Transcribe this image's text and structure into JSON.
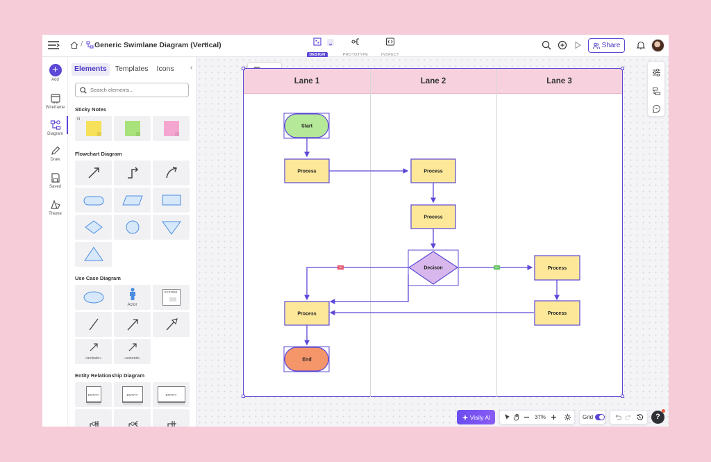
{
  "topbar": {
    "breadcrumb_sep": "/",
    "doc_title": "Generic Swimlane Diagram (Vertical)",
    "modes": [
      {
        "label": "DESIGN",
        "active": true
      },
      {
        "label": "PROTOTYPE",
        "active": false
      },
      {
        "label": "INSPECT",
        "active": false
      }
    ],
    "share_label": "Share"
  },
  "rail": {
    "items": [
      {
        "label": "Add",
        "icon": "plus-icon"
      },
      {
        "label": "Wireframe",
        "icon": "wireframe-icon"
      },
      {
        "label": "Diagram",
        "icon": "diagram-icon",
        "active": true
      },
      {
        "label": "Draw",
        "icon": "pen-icon"
      },
      {
        "label": "Saved",
        "icon": "saved-icon"
      },
      {
        "label": "Theme",
        "icon": "theme-icon"
      }
    ]
  },
  "panel": {
    "tabs": [
      "Elements",
      "Templates",
      "Icons"
    ],
    "active_tab": "Elements",
    "collapse_glyph": "‹",
    "search_placeholder": "Search elements...",
    "sections": {
      "sticky": "Sticky Notes",
      "flowchart": "Flowchart Diagram",
      "usecase": "Use Case Diagram",
      "er": "Entity Relationship Diagram"
    },
    "sticky_mark": "N",
    "sticky_colors": [
      "#f7e05a",
      "#a9e27a",
      "#f4a6d0"
    ],
    "actor_label": "Actor",
    "system_label": "SYSTEM",
    "include_label": "«include»",
    "extend_label": "«extend»",
    "entity_label": "ENTITY"
  },
  "canvas": {
    "lanes": [
      "Lane 1",
      "Lane 2",
      "Lane 3"
    ],
    "nodes": {
      "start": "Start",
      "process": "Process",
      "decision": "Decison",
      "end": "End"
    },
    "edge_labels": {
      "no": "No",
      "yes": "Yes"
    },
    "colors": {
      "accent": "#5b48d6",
      "lane_header": "#f7d2de",
      "process_fill": "#fde89a",
      "start_fill": "#b6e89a",
      "end_fill": "#f4956a",
      "decision_fill": "#d8b8ec",
      "no_label": "#e5566b",
      "yes_label": "#5cc25c"
    }
  },
  "bottom": {
    "ai_label": "Visily AI",
    "zoom": "37%",
    "grid_label": "Grid",
    "help": "?"
  }
}
